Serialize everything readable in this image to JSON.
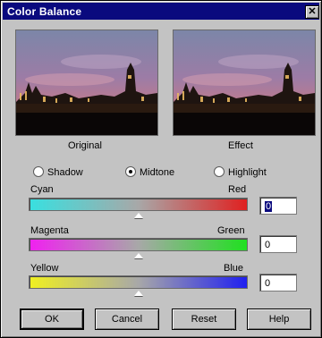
{
  "window": {
    "title": "Color Balance",
    "close_glyph": "✕"
  },
  "previews": {
    "original_label": "Original",
    "effect_label": "Effect"
  },
  "tone": {
    "options": [
      "Shadow",
      "Midtone",
      "Highlight"
    ],
    "selected": "Midtone"
  },
  "sliders": [
    {
      "left_label": "Cyan",
      "right_label": "Red",
      "value": "0",
      "position_fraction": 0.5,
      "colors": [
        "#38e0e0",
        "#e02020"
      ]
    },
    {
      "left_label": "Magenta",
      "right_label": "Green",
      "value": "0",
      "position_fraction": 0.5,
      "colors": [
        "#f020f0",
        "#20e020"
      ]
    },
    {
      "left_label": "Yellow",
      "right_label": "Blue",
      "value": "0",
      "position_fraction": 0.5,
      "colors": [
        "#f0f020",
        "#2020f0"
      ]
    }
  ],
  "buttons": {
    "ok": "OK",
    "cancel": "Cancel",
    "reset": "Reset",
    "help": "Help"
  },
  "colors": {
    "titlebar": "#0a0a7e",
    "dialog_face": "#c3c3c3"
  }
}
